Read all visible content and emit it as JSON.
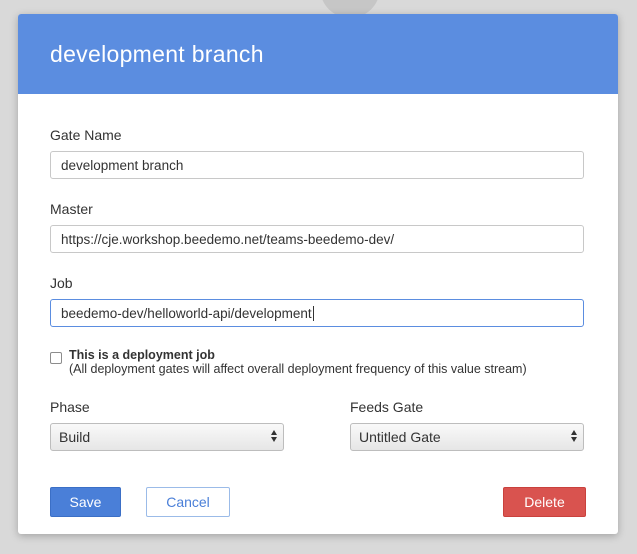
{
  "modal": {
    "title": "development branch"
  },
  "form": {
    "gate_name": {
      "label": "Gate Name",
      "value": "development branch"
    },
    "master": {
      "label": "Master",
      "value": "https://cje.workshop.beedemo.net/teams-beedemo-dev/"
    },
    "job": {
      "label": "Job",
      "value": "beedemo-dev/helloworld-api/development"
    },
    "deployment": {
      "checked": false,
      "label": "This is a deployment job",
      "hint": "(All deployment gates will affect overall deployment frequency of this value stream)"
    },
    "phase": {
      "label": "Phase",
      "selected": "Build"
    },
    "feeds_gate": {
      "label": "Feeds Gate",
      "selected": "Untitled Gate"
    }
  },
  "actions": {
    "save_label": "Save",
    "cancel_label": "Cancel",
    "delete_label": "Delete"
  },
  "colors": {
    "header_bg": "#5b8de0",
    "primary": "#4a7fd8",
    "danger": "#d9534f"
  },
  "icons": {
    "backdrop": "magnifier-icon",
    "select_arrows": "updown-arrows-icon"
  }
}
